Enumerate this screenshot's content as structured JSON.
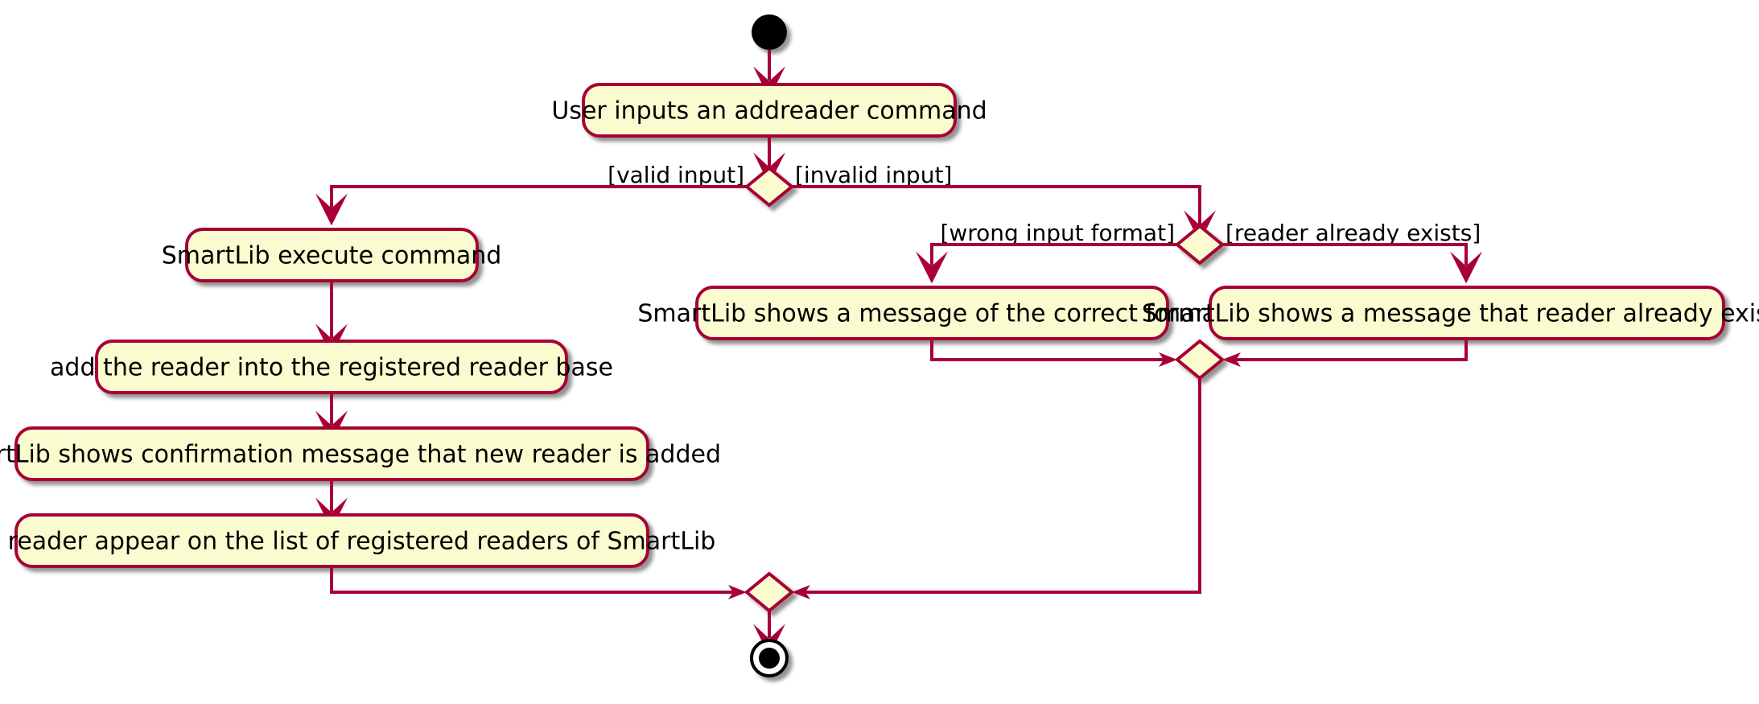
{
  "diagram": {
    "type": "activity",
    "title": "addreader command activity diagram",
    "colors": {
      "node_fill": "#FBFBD0",
      "node_stroke": "#A80036",
      "edge_stroke": "#A80036",
      "text": "#000000",
      "background": "#FFFFFF",
      "terminal_fill": "#000000",
      "shadow": "#808080"
    },
    "nodes": {
      "start": {
        "kind": "initial-node",
        "label": ""
      },
      "a1": {
        "kind": "activity",
        "label": "User inputs an addreader command"
      },
      "d1": {
        "kind": "decision",
        "label": ""
      },
      "a2": {
        "kind": "activity",
        "label": "SmartLib execute command"
      },
      "a3": {
        "kind": "activity",
        "label": "add the reader into the registered reader base"
      },
      "a4": {
        "kind": "activity",
        "label": "SmartLib shows confirmation message that new reader is added"
      },
      "a5": {
        "kind": "activity",
        "label": "New reader appear on the list of registered readers of SmartLib"
      },
      "d2": {
        "kind": "decision",
        "label": ""
      },
      "a6": {
        "kind": "activity",
        "label": "SmartLib shows a message of the correct format"
      },
      "a7": {
        "kind": "activity",
        "label": "SmartLib shows a message that reader already exists"
      },
      "m1": {
        "kind": "merge",
        "label": ""
      },
      "m2": {
        "kind": "merge",
        "label": ""
      },
      "end": {
        "kind": "final-node",
        "label": ""
      }
    },
    "guards": {
      "valid_input": "[valid input]",
      "invalid_input": "[invalid input]",
      "wrong_input_format": "[wrong input format]",
      "reader_already_exists": "[reader already exists]"
    }
  }
}
